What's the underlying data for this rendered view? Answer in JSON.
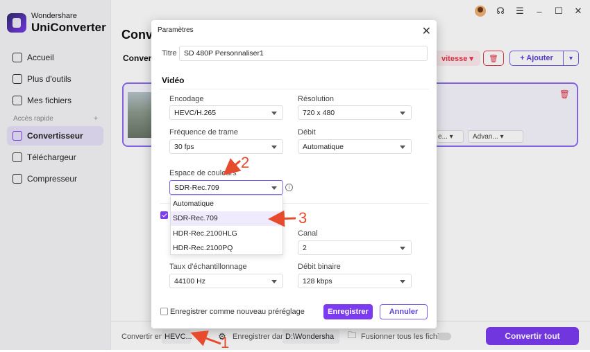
{
  "app": {
    "brand": "Wondershare",
    "name": "UniConverter"
  },
  "sidebar": {
    "items": [
      {
        "label": "Accueil",
        "icon": "home-icon"
      },
      {
        "label": "Plus d'outils",
        "icon": "tools-icon"
      },
      {
        "label": "Mes fichiers",
        "icon": "files-icon"
      },
      {
        "label": "Convertisseur",
        "icon": "converter-icon",
        "active": true
      },
      {
        "label": "Téléchargeur",
        "icon": "download-icon"
      },
      {
        "label": "Compresseur",
        "icon": "compress-icon"
      }
    ],
    "section_label": "Accès rapide",
    "section_add": "+"
  },
  "main": {
    "title": "Conv",
    "subtab": "Convers",
    "vitesse_label": "vitesse ▾",
    "add_label": "+ Ajouter",
    "card_ctrl_1": "e... ▾",
    "card_ctrl_2": "Advan... ▾"
  },
  "bottombar": {
    "convert_to_label": "Convertir en",
    "convert_to_value": "HEVC...",
    "save_in_label": "Enregistrer dans",
    "save_in_value": "D:\\Wondersha",
    "merge_label": "Fusionner tous les fichiers",
    "convert_all_label": "Convertir tout"
  },
  "modal": {
    "title": "Paramètres",
    "title_label": "Titre",
    "title_value": "SD 480P Personnaliser1",
    "video_section": "Vidéo",
    "encoding_label": "Encodage",
    "encoding_value": "HEVC/H.265",
    "resolution_label": "Résolution",
    "resolution_value": "720 x 480",
    "framerate_label": "Fréquence de trame",
    "framerate_value": "30 fps",
    "bitrate_label": "Débit",
    "bitrate_value": "Automatique",
    "colorspace_label": "Espace de couleurs",
    "colorspace_value": "SDR-Rec.709",
    "colorspace_options": [
      "Automatique",
      "SDR-Rec.709",
      "HDR-Rec.2100HLG",
      "HDR-Rec.2100PQ"
    ],
    "channel_label": "Canal",
    "channel_value": "2",
    "samplerate_label": "Taux d'échantillonnage",
    "samplerate_value": "44100 Hz",
    "audiobitrate_label": "Débit binaire",
    "audiobitrate_value": "128 kbps",
    "save_preset_label": "Enregistrer comme nouveau préréglage",
    "save_button": "Enregistrer",
    "cancel_button": "Annuler"
  },
  "annotations": {
    "one": "1",
    "two": "2",
    "three": "3"
  },
  "colors": {
    "accent": "#7b3bf0",
    "annotation": "#e64b2e",
    "danger": "#e5384a"
  }
}
